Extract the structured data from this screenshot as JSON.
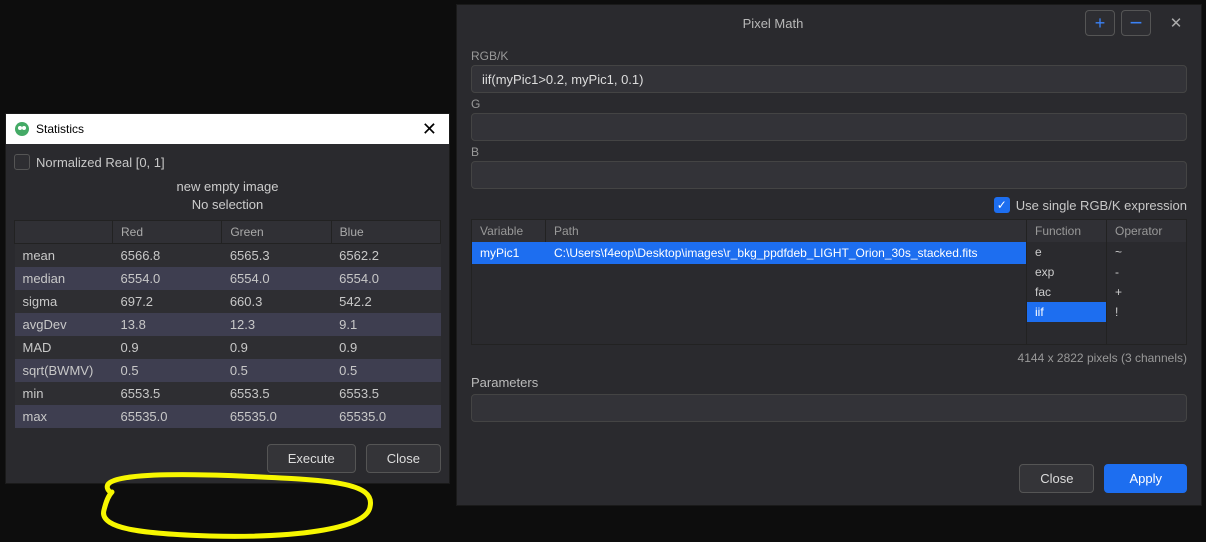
{
  "stats": {
    "title": "Statistics",
    "normalized_label": "Normalized Real [0, 1]",
    "normalized_checked": false,
    "subtitle1": "new empty image",
    "subtitle2": "No selection",
    "columns": {
      "c0": "",
      "c1": "Red",
      "c2": "Green",
      "c3": "Blue"
    },
    "rows": [
      {
        "label": "mean",
        "red": "6566.8",
        "green": "6565.3",
        "blue": "6562.2"
      },
      {
        "label": "median",
        "red": "6554.0",
        "green": "6554.0",
        "blue": "6554.0"
      },
      {
        "label": "sigma",
        "red": "697.2",
        "green": "660.3",
        "blue": "542.2"
      },
      {
        "label": "avgDev",
        "red": "13.8",
        "green": "12.3",
        "blue": "9.1"
      },
      {
        "label": "MAD",
        "red": "0.9",
        "green": "0.9",
        "blue": "0.9"
      },
      {
        "label": "sqrt(BWMV)",
        "red": "0.5",
        "green": "0.5",
        "blue": "0.5"
      },
      {
        "label": "min",
        "red": "6553.5",
        "green": "6553.5",
        "blue": "6553.5"
      },
      {
        "label": "max",
        "red": "65535.0",
        "green": "65535.0",
        "blue": "65535.0"
      }
    ],
    "buttons": {
      "execute": "Execute",
      "close": "Close"
    }
  },
  "pixelmath": {
    "title": "Pixel Math",
    "channels": {
      "rgbk_label": "RGB/K",
      "rgbk_value": "iif(myPic1>0.2, myPic1, 0.1)",
      "g_label": "G",
      "g_value": "",
      "b_label": "B",
      "b_value": ""
    },
    "use_single_label": "Use single RGB/K expression",
    "use_single_checked": true,
    "vars": {
      "header_variable": "Variable",
      "header_path": "Path",
      "rows": [
        {
          "variable": "myPic1",
          "path": "C:\\Users\\f4eop\\Desktop\\images\\r_bkg_ppdfdeb_LIGHT_Orion_30s_stacked.fits"
        }
      ]
    },
    "functions": {
      "header": "Function",
      "items": [
        "e",
        "exp",
        "fac",
        "iif"
      ],
      "selected": "iif"
    },
    "operators": {
      "header": "Operator",
      "items": [
        "~",
        "-",
        "+",
        "!"
      ]
    },
    "image_dims": "4144 x 2822 pixels (3 channels)",
    "parameters_label": "Parameters",
    "parameters_value": "",
    "buttons": {
      "close": "Close",
      "apply": "Apply"
    }
  },
  "chart_data": {
    "type": "table",
    "title": "Statistics",
    "columns": [
      "",
      "Red",
      "Green",
      "Blue"
    ],
    "rows": [
      [
        "mean",
        6566.8,
        6565.3,
        6562.2
      ],
      [
        "median",
        6554.0,
        6554.0,
        6554.0
      ],
      [
        "sigma",
        697.2,
        660.3,
        542.2
      ],
      [
        "avgDev",
        13.8,
        12.3,
        9.1
      ],
      [
        "MAD",
        0.9,
        0.9,
        0.9
      ],
      [
        "sqrt(BWMV)",
        0.5,
        0.5,
        0.5
      ],
      [
        "min",
        6553.5,
        6553.5,
        6553.5
      ],
      [
        "max",
        65535.0,
        65535.0,
        65535.0
      ]
    ]
  }
}
